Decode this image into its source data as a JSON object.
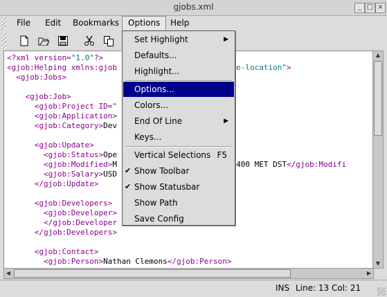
{
  "window": {
    "title": "gjobs.xml",
    "buttons": [
      "_",
      "□",
      "×"
    ]
  },
  "menubar": [
    "File",
    "Edit",
    "Bookmarks",
    "Options",
    "Help"
  ],
  "toolbar": {
    "icons": [
      "new-file-icon",
      "open-file-icon",
      "save-file-icon",
      "cut-icon",
      "copy-icon"
    ]
  },
  "editor": {
    "lines": [
      [
        {
          "t": "<?xml version=",
          "c": "tag"
        },
        {
          "t": "\"1.0\"",
          "c": "str"
        },
        {
          "t": "?>",
          "c": "tag"
        }
      ],
      [
        {
          "t": "<gjob:Helping xmlns:gjob",
          "c": "tag"
        },
        {
          "t": "                       ",
          "c": ""
        },
        {
          "t": "some-location\"",
          "c": "str"
        },
        {
          "t": ">",
          "c": "tag"
        }
      ],
      [
        {
          "t": "  <gjob:Jobs>",
          "c": "tag"
        }
      ],
      [],
      [
        {
          "t": "    <gjob:Job>",
          "c": "tag"
        }
      ],
      [
        {
          "t": "      <gjob:Project ID=\"",
          "c": "tag"
        }
      ],
      [
        {
          "t": "      <gjob:Application>",
          "c": "tag"
        },
        {
          "t": "                     on>",
          "c": "tag"
        }
      ],
      [
        {
          "t": "      <gjob:Category>",
          "c": "tag"
        },
        {
          "t": "Dev",
          "c": ""
        },
        {
          "t": "                      >",
          "c": "tag"
        }
      ],
      [],
      [
        {
          "t": "      <gjob:Update>",
          "c": "tag"
        }
      ],
      [
        {
          "t": "        <gjob:Status>",
          "c": "tag"
        },
        {
          "t": "Ope",
          "c": ""
        }
      ],
      [
        {
          "t": "        <gjob:Modified>",
          "c": "tag"
        },
        {
          "t": "M",
          "c": ""
        },
        {
          "t": "                      6 -0400 MET DST",
          "c": ""
        },
        {
          "t": "</gjob:Modifi",
          "c": "tag"
        }
      ],
      [
        {
          "t": "        <gjob:Salary>",
          "c": "tag"
        },
        {
          "t": "USD",
          "c": ""
        }
      ],
      [
        {
          "t": "      </gjob:Update>",
          "c": "tag"
        }
      ],
      [],
      [
        {
          "t": "      <gjob:Developers>",
          "c": "tag"
        }
      ],
      [
        {
          "t": "        <gjob:Developer>",
          "c": "tag"
        }
      ],
      [
        {
          "t": "        </gjob:Developer",
          "c": "tag"
        }
      ],
      [
        {
          "t": "      </gjob:Developers>",
          "c": "tag"
        }
      ],
      [],
      [
        {
          "t": "      <gjob:Contact>",
          "c": "tag"
        }
      ],
      [
        {
          "t": "        <gjob:Person>",
          "c": "tag"
        },
        {
          "t": "Nathan Clemons",
          "c": ""
        },
        {
          "t": "</gjob:Person>",
          "c": "tag"
        }
      ]
    ]
  },
  "options_menu": {
    "items": [
      {
        "label": "Set Highlight",
        "submenu": true
      },
      {
        "label": "Defaults..."
      },
      {
        "label": "Highlight..."
      },
      {
        "sep": true
      },
      {
        "label": "Options...",
        "highlighted": true
      },
      {
        "label": "Colors..."
      },
      {
        "label": "End Of Line",
        "submenu": true
      },
      {
        "label": "Keys..."
      },
      {
        "sep": true
      },
      {
        "label": "Vertical Selections",
        "accel": "F5"
      },
      {
        "label": "Show Toolbar",
        "checked": true
      },
      {
        "label": "Show Statusbar",
        "checked": true
      },
      {
        "label": "Show Path"
      },
      {
        "label": "Save Config"
      }
    ]
  },
  "statusbar": {
    "mode": "INS",
    "position": "Line: 13 Col: 21"
  }
}
